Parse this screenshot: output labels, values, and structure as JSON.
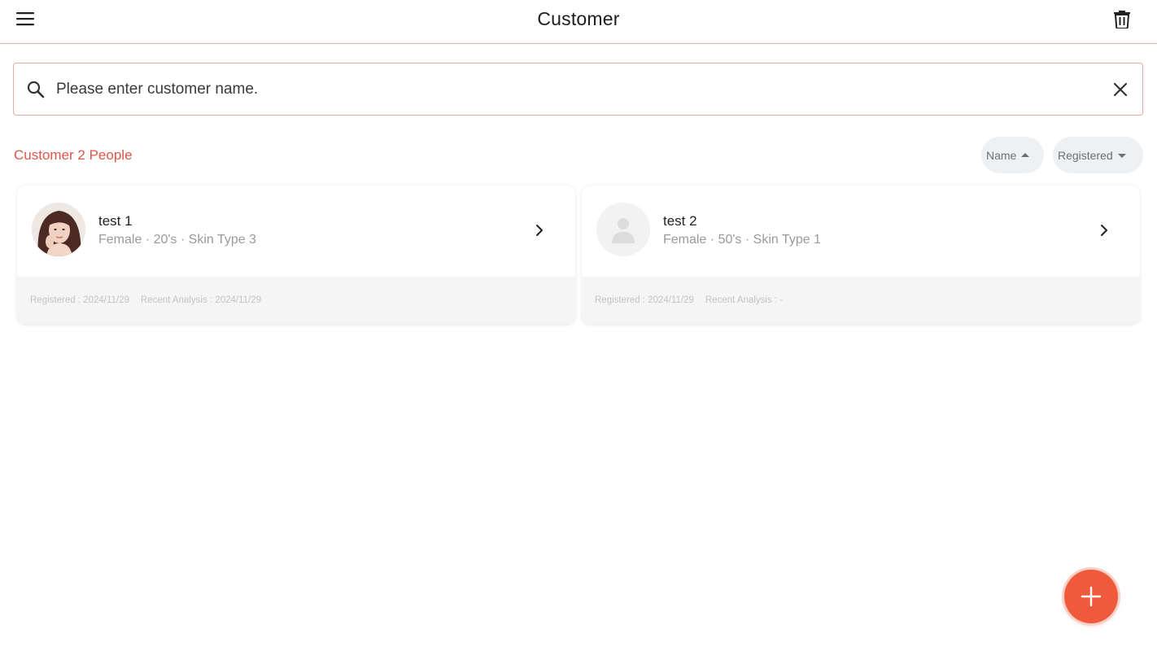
{
  "header": {
    "title": "Customer"
  },
  "search": {
    "placeholder": "Please enter customer name.",
    "value": ""
  },
  "list": {
    "count_label": "Customer 2 People",
    "sort": {
      "name_label": "Name",
      "name_direction": "asc",
      "registered_label": "Registered",
      "registered_direction": "desc"
    }
  },
  "customers": [
    {
      "name": "test 1",
      "meta": "Female · 20's · Skin Type 3",
      "registered": "Registered : 2024/11/29",
      "recent_analysis": "Recent Analysis : 2024/11/29",
      "avatar": "photo"
    },
    {
      "name": "test 2",
      "meta": "Female · 50's · Skin Type 1",
      "registered": "Registered : 2024/11/29",
      "recent_analysis": "Recent Analysis : -",
      "avatar": "placeholder-person-icon"
    }
  ],
  "colors": {
    "accent": "#e0554a",
    "fab": "#f05a3c",
    "border": "#e7a9a3"
  }
}
